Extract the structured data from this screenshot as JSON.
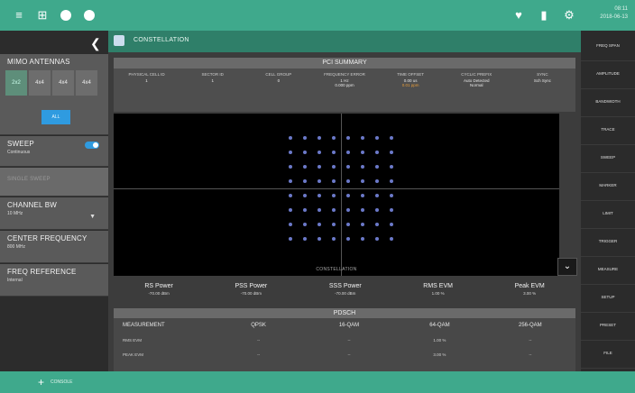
{
  "topbar": {
    "time": "08:11",
    "date": "2018-06-13"
  },
  "left": {
    "mimo": {
      "title": "MIMO ANTENNAS",
      "antennas": [
        "2x2",
        "4x4",
        "4x4",
        "4x4"
      ],
      "button": "ALL"
    },
    "sweep": {
      "title": "SWEEP",
      "sub": "Continuous"
    },
    "single": {
      "title": "SINGLE SWEEP"
    },
    "channel_bw": {
      "title": "CHANNEL BW",
      "value": "10 MHz"
    },
    "center_freq": {
      "title": "CENTER FREQUENCY",
      "value": "800 MHz"
    },
    "freq_ref": {
      "title": "FREQ REFERENCE",
      "value": "Internal"
    }
  },
  "main": {
    "title": "CONSTELLATION",
    "pci": {
      "title": "PCI SUMMARY",
      "cols": [
        {
          "h": "PHYSICAL CELL ID",
          "v": "1",
          "v2": "",
          "v2_orange": false
        },
        {
          "h": "SECTOR ID",
          "v": "1",
          "v2": "",
          "v2_orange": false
        },
        {
          "h": "CELL GROUP",
          "v": "0",
          "v2": "",
          "v2_orange": false
        },
        {
          "h": "FREQUENCY ERROR",
          "v": "1 Hz",
          "v2": "0.000 ppm",
          "v2_orange": false
        },
        {
          "h": "TIME OFFSET",
          "v": "0.00 us",
          "v2": "0.01 ppm",
          "v2_orange": true
        },
        {
          "h": "CYCLIC PREFIX",
          "v": "Auto Detected",
          "v2": "Normal",
          "v2_orange": false
        },
        {
          "h": "SYNC",
          "v": "Sch Sync",
          "v2": "",
          "v2_orange": false
        }
      ]
    },
    "plot_label": "CONSTELLATION",
    "measurements": [
      {
        "h": "RS Power",
        "v": "-70.00 dBm"
      },
      {
        "h": "PSS Power",
        "v": "-70.00 dBm"
      },
      {
        "h": "SSS Power",
        "v": "-70.00 dBm"
      },
      {
        "h": "RMS EVM",
        "v": "1.00 %"
      },
      {
        "h": "Peak EVM",
        "v": "3.00 %"
      }
    ],
    "pdsch": {
      "title": "PDSCH",
      "headers": [
        "MEASUREMENT",
        "QPSK",
        "16-QAM",
        "64-QAM",
        "256-QAM"
      ],
      "rows": [
        [
          "RMS EVM",
          "--",
          "--",
          "1.00 %",
          "--"
        ],
        [
          "PEAK EVM",
          "--",
          "--",
          "3.00 %",
          "--"
        ]
      ]
    }
  },
  "right_menu": [
    "FREQ SPAN",
    "AMPLITUDE",
    "BANDWIDTH",
    "TRACE",
    "SWEEP",
    "MARKER",
    "LIMIT",
    "TRIGGER",
    "MEASURE",
    "SETUP",
    "PRESET",
    "FILE"
  ],
  "bottom": {
    "label": "CONSOLE"
  },
  "chart_data": {
    "type": "scatter",
    "title": "CONSTELLATION",
    "grid": "8x8",
    "i_levels": [
      -7,
      -5,
      -3,
      -1,
      1,
      3,
      5,
      7
    ],
    "q_levels": [
      -7,
      -5,
      -3,
      -1,
      1,
      3,
      5,
      7
    ],
    "color": "#6b79c9"
  }
}
